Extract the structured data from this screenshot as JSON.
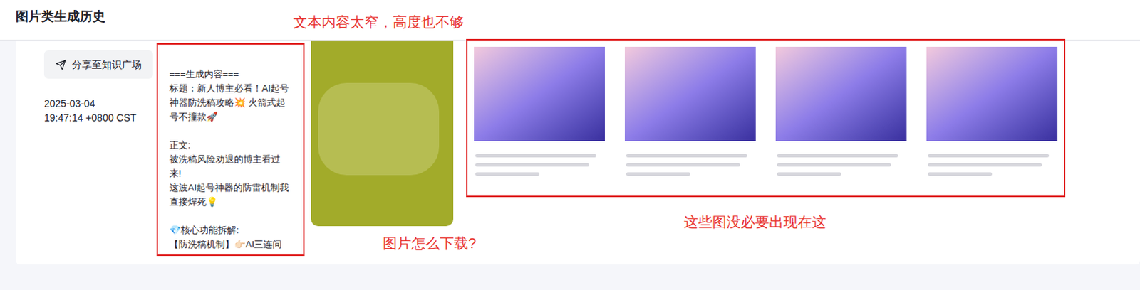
{
  "page": {
    "title": "图片类生成历史"
  },
  "record": {
    "share_button": "分享至知识广场",
    "date": "2025-03-04",
    "time": "19:47:14 +0800 CST",
    "content": "===生成内容===\n标题：新人博主必看！AI起号神器防洗稿攻略💥 火箭式起号不撞款🚀\n\n正文:\n被洗稿风险劝退的博主看过来!\n这波AI起号神器的防雷机制我直接焊死💡\n\n💎核心功能拆解:\n【防洗稿机制】👉🏻AI三连问",
    "images": [
      {
        "kind": "cover"
      },
      {
        "kind": "card"
      },
      {
        "kind": "card"
      },
      {
        "kind": "card"
      },
      {
        "kind": "card"
      }
    ]
  },
  "annotations": [
    {
      "text": "文本内容太窄，高度也不够"
    },
    {
      "text": "图片怎么下载?"
    },
    {
      "text": "这些图没必要出现在这"
    }
  ]
}
